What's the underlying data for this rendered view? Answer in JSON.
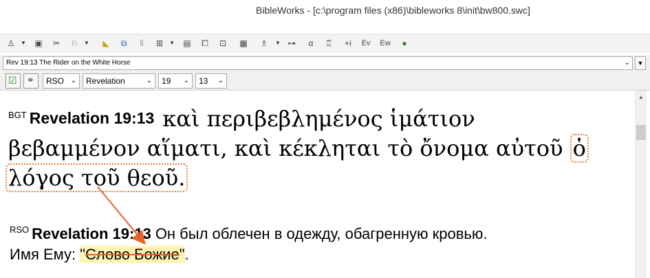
{
  "window": {
    "title": "BibleWorks - [c:\\program files (x86)\\bibleworks 8\\init\\bw800.swc]"
  },
  "toolbar": {
    "icons": [
      "search-icon",
      "dropdown-icon",
      "window-icon",
      "tools-icon",
      "user-icon",
      "dropdown-icon",
      "highlight-icon",
      "split-window-icon",
      "bars-icon",
      "grid-icon",
      "dropdown-icon",
      "document-icon",
      "copy-icon",
      "folder-icon",
      "keyboard-icon",
      "person-icon",
      "dropdown-icon",
      "tree-icon",
      "alpha-icon",
      "person-read-icon",
      "add-icon",
      "tv-icon",
      "tw-icon",
      "globe-icon"
    ],
    "labels": {
      "plus_i": "+i",
      "tv": "Ev",
      "tw": "Ew",
      "alpha": "α"
    }
  },
  "passage": {
    "value": "Rev 19:13 The Rider on the White Horse"
  },
  "nav": {
    "version": "RSO",
    "book": "Revelation",
    "chapter": "19",
    "verse": "13"
  },
  "verses": [
    {
      "version": "BGT",
      "reference": "Revelation 19:13",
      "text_line1": "καὶ περιβεβλημένος ἱμάτιον",
      "text_line2_a": "βεβαμμένον αἵματι, καὶ κέκληται τὸ ὄνομα αὐτοῦ",
      "text_line2_hl": "ὁ",
      "text_line3_hl": "λόγος τοῦ θεοῦ."
    },
    {
      "version": "RSO",
      "reference": "Revelation 19:13",
      "text_a": "Он был облечен в одежду, обагренную кровью.",
      "text_b": "Имя Ему: ",
      "marked_quote_open": "\"",
      "marked_strike": "Слово Божие",
      "marked_quote_close": "\"",
      "text_end": "."
    }
  ],
  "colors": {
    "annotation": "#e8622a",
    "highlight": "#fff5b3"
  }
}
